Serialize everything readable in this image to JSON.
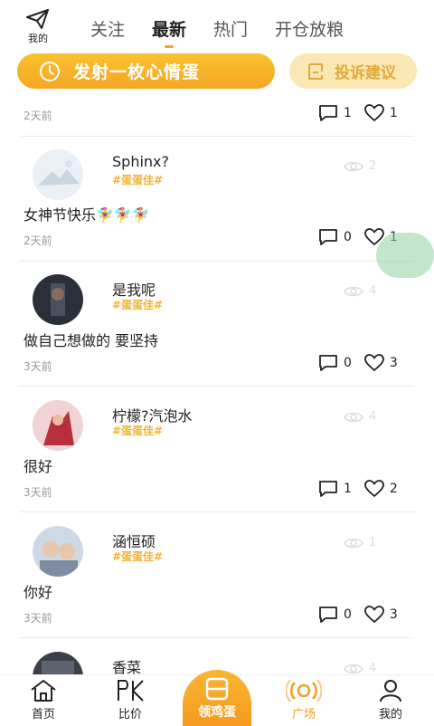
{
  "topbar": {
    "me_label": "我的",
    "tabs": [
      {
        "label": "关注"
      },
      {
        "label": "最新"
      },
      {
        "label": "热门"
      },
      {
        "label": "开仓放粮"
      }
    ]
  },
  "cta": {
    "main_label": "发射一枚心情蛋",
    "feedback_label": "投诉建议"
  },
  "feed": {
    "partial_post": {
      "time": "2天前",
      "comments": "1",
      "likes": "1"
    },
    "posts": [
      {
        "name": "Sphinx?",
        "tag": "#蛋蛋佳#",
        "views": "2",
        "content": "女神节快乐🧚‍♀️🧚‍♀️🧚‍♀️",
        "time": "2天前",
        "comments": "0",
        "likes": "1"
      },
      {
        "name": "是我呢",
        "tag": "#蛋蛋佳#",
        "views": "4",
        "content": "做自己想做的 要坚持",
        "time": "3天前",
        "comments": "0",
        "likes": "3"
      },
      {
        "name": "柠檬?汽泡水",
        "tag": "#蛋蛋佳#",
        "views": "4",
        "content": "很好",
        "time": "3天前",
        "comments": "1",
        "likes": "2"
      },
      {
        "name": "涵恒硕",
        "tag": "#蛋蛋佳#",
        "views": "1",
        "content": "你好",
        "time": "3天前",
        "comments": "0",
        "likes": "3"
      },
      {
        "name": "香菜",
        "views": "4"
      }
    ]
  },
  "navbar": {
    "home": "首页",
    "compare": "比价",
    "center": "领鸡蛋",
    "square": "广场",
    "mine": "我的"
  },
  "colors": {
    "accent": "#f5a623",
    "tag": "#f1b33a",
    "feedback_bg": "#fbe7b3"
  }
}
